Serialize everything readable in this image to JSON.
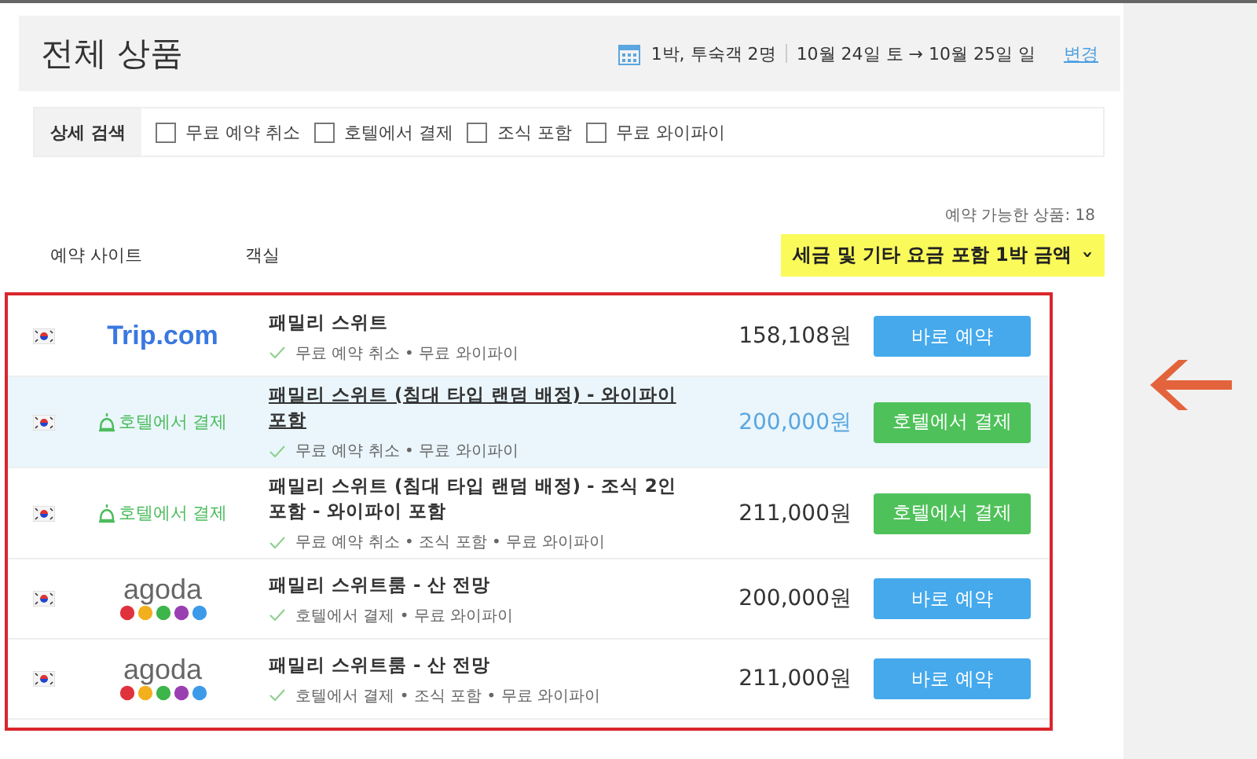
{
  "header": {
    "title": "전체 상품",
    "stay": "1박, 투숙객 2명",
    "dates": "10월 24일 토 → 10월 25일 일",
    "change_link": "변경"
  },
  "filters": {
    "label": "상세 검색",
    "options": [
      {
        "label": "무료 예약 취소",
        "checked": false
      },
      {
        "label": "호텔에서 결제",
        "checked": false
      },
      {
        "label": "조식 포함",
        "checked": false
      },
      {
        "label": "무료 와이파이",
        "checked": false
      }
    ]
  },
  "available_count": "예약 가능한 상품: 18",
  "columns": {
    "site": "예약 사이트",
    "room": "객실",
    "price_sort": "세금 및 기타 요금 포함 1박 금액",
    "sort_caret": "›"
  },
  "offers": [
    {
      "site": {
        "kind": "trip",
        "text": "Trip.com"
      },
      "room": "패밀리 스위트",
      "features": "무료 예약 취소 • 무료 와이파이",
      "price": "158,108원",
      "button": {
        "kind": "book",
        "label": "바로 예약"
      },
      "selected": false
    },
    {
      "site": {
        "kind": "hotel",
        "text": "호텔에서 결제"
      },
      "room": "패밀리 스위트 (침대 타입 랜덤 배정) - 와이파이 포함",
      "features": "무료 예약 취소 • 무료 와이파이",
      "price": "200,000원",
      "button": {
        "kind": "pay",
        "label": "호텔에서 결제"
      },
      "selected": true
    },
    {
      "site": {
        "kind": "hotel",
        "text": "호텔에서 결제"
      },
      "room": "패밀리 스위트 (침대 타입 랜덤 배정) - 조식 2인 포함 - 와이파이 포함",
      "features": "무료 예약 취소 • 조식 포함 • 무료 와이파이",
      "price": "211,000원",
      "button": {
        "kind": "pay",
        "label": "호텔에서 결제"
      },
      "selected": false
    },
    {
      "site": {
        "kind": "agoda",
        "text": "agoda"
      },
      "room": "패밀리 스위트룸 - 산 전망",
      "features": "호텔에서 결제 • 무료 와이파이",
      "price": "200,000원",
      "button": {
        "kind": "book",
        "label": "바로 예약"
      },
      "selected": false
    },
    {
      "site": {
        "kind": "agoda",
        "text": "agoda"
      },
      "room": "패밀리 스위트룸 - 산 전망",
      "features": "호텔에서 결제 • 조식 포함 • 무료 와이파이",
      "price": "211,000원",
      "button": {
        "kind": "book",
        "label": "바로 예약"
      },
      "selected": false
    }
  ]
}
